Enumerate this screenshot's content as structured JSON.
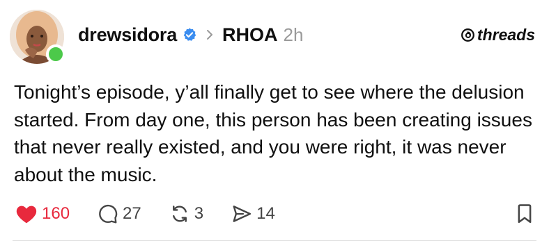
{
  "post": {
    "username": "drewsidora",
    "community": "RHOA",
    "timestamp": "2h",
    "brand": "threads",
    "text": "Tonight’s episode, y’all finally get to see where the delusion started. From day one, this person has been creating issues that never really existed, and you were right, it was never about the music."
  },
  "actions": {
    "likes": "160",
    "comments": "27",
    "reposts": "3",
    "shares": "14"
  },
  "colors": {
    "like": "#e8293d",
    "verified": "#3b8df0",
    "online": "#4cc94a",
    "muted": "#9a9a9a"
  },
  "icons": [
    "avatar",
    "verified-badge-icon",
    "chevron-right-icon",
    "threads-logo-icon",
    "heart-icon",
    "comment-icon",
    "repost-icon",
    "share-icon",
    "bookmark-icon"
  ]
}
